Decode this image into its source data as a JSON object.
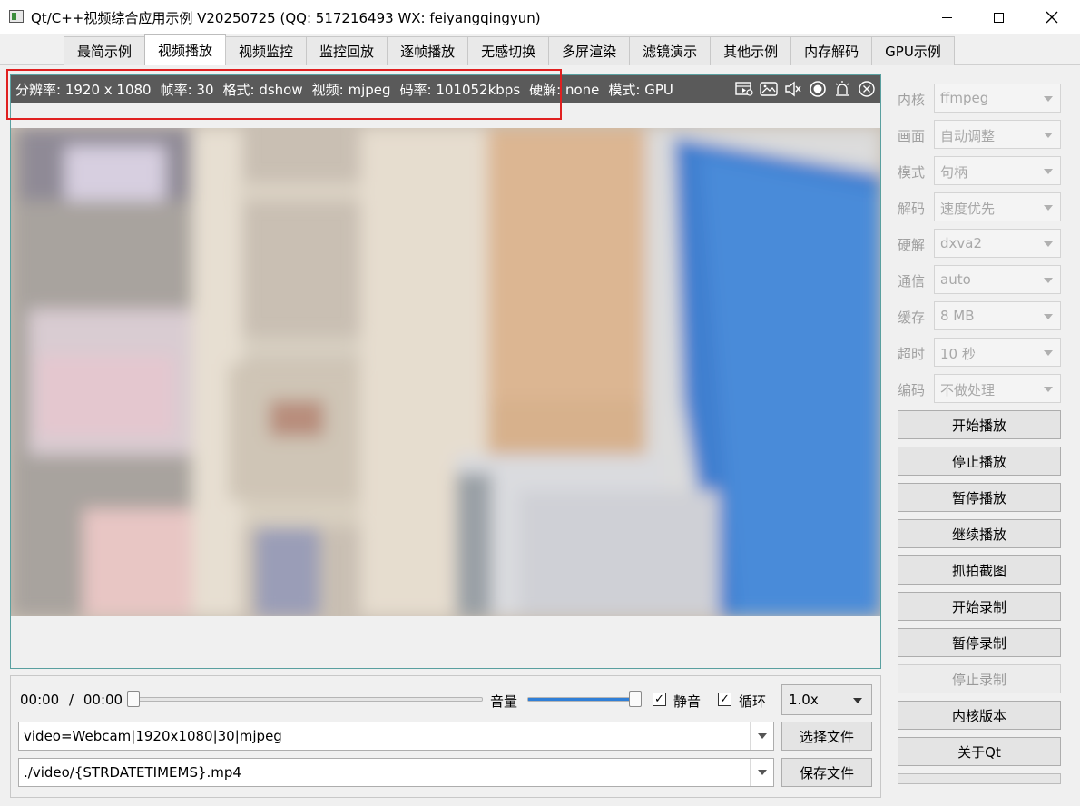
{
  "window": {
    "title": "Qt/C++视频综合应用示例 V20250725 (QQ: 517216493 WX: feiyangqingyun)"
  },
  "tabs": [
    {
      "label": "最简示例",
      "active": false
    },
    {
      "label": "视频播放",
      "active": true
    },
    {
      "label": "视频监控",
      "active": false
    },
    {
      "label": "监控回放",
      "active": false
    },
    {
      "label": "逐帧播放",
      "active": false
    },
    {
      "label": "无感切换",
      "active": false
    },
    {
      "label": "多屏渲染",
      "active": false
    },
    {
      "label": "滤镜演示",
      "active": false
    },
    {
      "label": "其他示例",
      "active": false
    },
    {
      "label": "内存解码",
      "active": false
    },
    {
      "label": "GPU示例",
      "active": false
    }
  ],
  "overlay": {
    "resolution": "分辨率: 1920 x 1080",
    "fps": "帧率: 30",
    "format": "格式: dshow",
    "video": "视频: mjpeg",
    "bitrate": "码率: 101052kbps",
    "hwdecode": "硬解: none",
    "mode": "模式: GPU",
    "icons": [
      "record-icon",
      "snapshot-icon",
      "mute-icon",
      "capture-icon",
      "alarm-icon",
      "close-icon"
    ]
  },
  "settings": [
    {
      "label": "内核",
      "value": "ffmpeg"
    },
    {
      "label": "画面",
      "value": "自动调整"
    },
    {
      "label": "模式",
      "value": "句柄"
    },
    {
      "label": "解码",
      "value": "速度优先"
    },
    {
      "label": "硬解",
      "value": "dxva2"
    },
    {
      "label": "通信",
      "value": "auto"
    },
    {
      "label": "缓存",
      "value": "8 MB"
    },
    {
      "label": "超时",
      "value": "10 秒"
    },
    {
      "label": "编码",
      "value": "不做处理"
    }
  ],
  "actions": [
    {
      "label": "开始播放",
      "enabled": true
    },
    {
      "label": "停止播放",
      "enabled": true
    },
    {
      "label": "暂停播放",
      "enabled": true
    },
    {
      "label": "继续播放",
      "enabled": true
    },
    {
      "label": "抓拍截图",
      "enabled": true
    },
    {
      "label": "开始录制",
      "enabled": true
    },
    {
      "label": "暂停录制",
      "enabled": true
    },
    {
      "label": "停止录制",
      "enabled": false
    },
    {
      "label": "内核版本",
      "enabled": true
    },
    {
      "label": "关于Qt",
      "enabled": true
    }
  ],
  "controls": {
    "time_current": "00:00",
    "time_sep": "/",
    "time_total": "00:00",
    "position_fraction": 0.0,
    "volume_label": "音量",
    "volume_fraction": 1.0,
    "mute_label": "静音",
    "mute_checked": true,
    "loop_label": "循环",
    "loop_checked": true,
    "speed": "1.0x",
    "url": "video=Webcam|1920x1080|30|mjpeg",
    "select_file": "选择文件",
    "save_path": "./video/{STRDATETIMEMS}.mp4",
    "save_file": "保存文件"
  },
  "colors": {
    "overlay_bg": "#5a5a5a",
    "highlight_box": "#e02020",
    "slider_fill": "#2f7fd7"
  }
}
